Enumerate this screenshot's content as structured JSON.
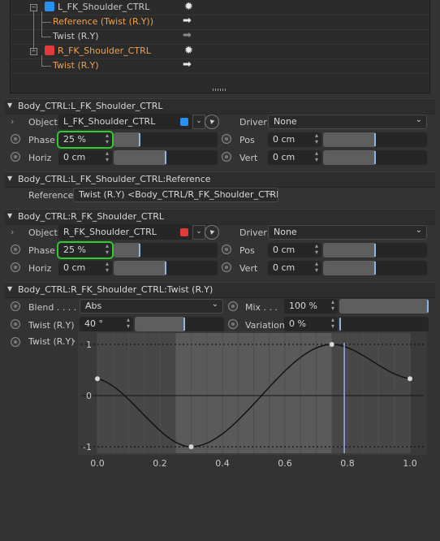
{
  "tree": {
    "rows": [
      {
        "label": "L_FK_Shoulder_CTRL",
        "type": "object-blue",
        "action": "sun"
      },
      {
        "label": "Reference (Twist (R.Y))",
        "type": "ref",
        "action": "arrow"
      },
      {
        "label": "Twist (R.Y)",
        "type": "child",
        "action": "arrow-dim"
      },
      {
        "label": "R_FK_Shoulder_CTRL",
        "type": "object-red",
        "action": "sun"
      },
      {
        "label": "Twist (R.Y)",
        "type": "ref",
        "action": "arrow"
      }
    ]
  },
  "sections": {
    "s1": {
      "title": "Body_CTRL:L_FK_Shoulder_CTRL",
      "object_label": "Object",
      "object_value": "L_FK_Shoulder_CTRL",
      "driver_label": "Driver",
      "driver_value": "None",
      "phase_label": "Phase",
      "phase_value": "25 %",
      "phase_fraction": 0.25,
      "pos_label": "Pos",
      "pos_value": "0 cm",
      "pos_fraction": 0.5,
      "horiz_label": "Horiz",
      "horiz_value": "0 cm",
      "horiz_fraction": 0.5,
      "vert_label": "Vert",
      "vert_value": "0 cm",
      "vert_fraction": 0.5,
      "object_color": "#2a8ff0"
    },
    "s2": {
      "title": "Body_CTRL:L_FK_Shoulder_CTRL:Reference",
      "reference_label": "Reference",
      "reference_value": "Twist (R.Y) <Body_CTRL/R_FK_Shoulder_CTRL>"
    },
    "s3": {
      "title": "Body_CTRL:R_FK_Shoulder_CTRL",
      "object_label": "Object",
      "object_value": "R_FK_Shoulder_CTRL",
      "driver_label": "Driver",
      "driver_value": "None",
      "phase_label": "Phase",
      "phase_value": "25 %",
      "phase_fraction": 0.25,
      "pos_label": "Pos",
      "pos_value": "0 cm",
      "pos_fraction": 0.5,
      "horiz_label": "Horiz",
      "horiz_value": "0 cm",
      "horiz_fraction": 0.5,
      "vert_label": "Vert",
      "vert_value": "0 cm",
      "vert_fraction": 0.5,
      "object_color": "#e03a3a"
    },
    "s4": {
      "title": "Body_CTRL:R_FK_Shoulder_CTRL:Twist (R.Y)",
      "blend_label": "Blend . . . .",
      "blend_value": "Abs",
      "mix_label": "Mix . . .",
      "mix_value": "100 %",
      "mix_fraction": 1.0,
      "twist_label": "Twist (R.Y)",
      "twist_value": "40 °",
      "twist_fraction": 0.55,
      "variation_label": "Variation",
      "variation_value": "0 %",
      "variation_fraction": 0.0,
      "curve_label": "Twist (R.Y)"
    }
  },
  "chart_data": {
    "type": "line",
    "x_ticks": [
      "0.0",
      "0.2",
      "0.4",
      "0.6",
      "0.8",
      "1.0"
    ],
    "y_ticks": [
      "1",
      "0",
      "-1"
    ],
    "xlim": [
      0,
      1
    ],
    "ylim": [
      -1,
      1
    ],
    "keys": [
      {
        "x": 0.0,
        "y": 0.33
      },
      {
        "x": 0.3,
        "y": -1.0
      },
      {
        "x": 0.75,
        "y": 1.0
      },
      {
        "x": 1.0,
        "y": 0.33
      }
    ],
    "playhead_x": 0.79,
    "highlight_range": [
      0.25,
      0.75
    ],
    "curve_color": "#111111",
    "playhead_color": "#8fb4e6"
  }
}
